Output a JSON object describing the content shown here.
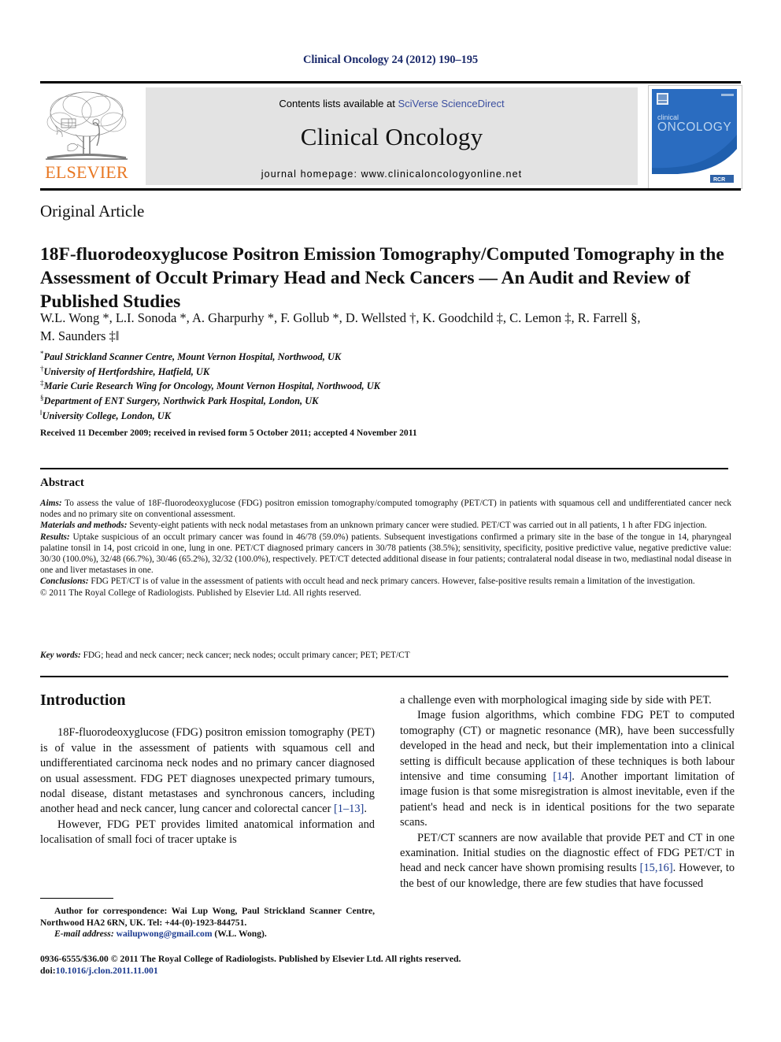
{
  "running_head": "Clinical Oncology 24 (2012) 190–195",
  "masthead": {
    "publisher_name": "ELSEVIER",
    "contents_prefix": "Contents lists available at ",
    "contents_link": "SciVerse ScienceDirect",
    "journal_title": "Clinical Oncology",
    "homepage_prefix": "journal homepage: ",
    "homepage_url": "www.clinicaloncologyonline.net",
    "cover": {
      "small_title": "clinical",
      "large_title": "ONCOLOGY",
      "footer_badge": "RCR"
    }
  },
  "article": {
    "type": "Original Article",
    "title": "18F-fluorodeoxyglucose Positron Emission Tomography/Computed Tomography in the Assessment of Occult Primary Head and Neck Cancers — An Audit and Review of Published Studies",
    "authors_line_1": "W.L. Wong *, L.I. Sonoda *, A. Gharpurhy *, F. Gollub *, D. Wellsted †, K. Goodchild ‡, C. Lemon ‡, R. Farrell §,",
    "authors_line_2": "M. Saunders ‡‖",
    "affiliations": [
      {
        "symbol": "*",
        "text": "Paul Strickland Scanner Centre, Mount Vernon Hospital, Northwood, UK"
      },
      {
        "symbol": "†",
        "text": "University of Hertfordshire, Hatfield, UK"
      },
      {
        "symbol": "‡",
        "text": "Marie Curie Research Wing for Oncology, Mount Vernon Hospital, Northwood, UK"
      },
      {
        "symbol": "§",
        "text": "Department of ENT Surgery, Northwick Park Hospital, London, UK"
      },
      {
        "symbol": "‖",
        "text": "University College, London, UK"
      }
    ],
    "history": "Received 11 December 2009; received in revised form 5 October 2011; accepted 4 November 2011"
  },
  "abstract": {
    "heading": "Abstract",
    "aims_label": "Aims:",
    "aims_text": " To assess the value of 18F-fluorodeoxyglucose (FDG) positron emission tomography/computed tomography (PET/CT) in patients with squamous cell and undifferentiated cancer neck nodes and no primary site on conventional assessment.",
    "methods_label": "Materials and methods:",
    "methods_text": " Seventy-eight patients with neck nodal metastases from an unknown primary cancer were studied. PET/CT was carried out in all patients, 1 h after FDG injection.",
    "results_label": "Results:",
    "results_text": " Uptake suspicious of an occult primary cancer was found in 46/78 (59.0%) patients. Subsequent investigations confirmed a primary site in the base of the tongue in 14, pharyngeal palatine tonsil in 14, post cricoid in one, lung in one. PET/CT diagnosed primary cancers in 30/78 patients (38.5%); sensitivity, specificity, positive predictive value, negative predictive value: 30/30 (100.0%), 32/48 (66.7%), 30/46 (65.2%), 32/32 (100.0%), respectively. PET/CT detected additional disease in four patients; contralateral nodal disease in two, mediastinal nodal disease in one and liver metastases in one.",
    "conclusions_label": "Conclusions:",
    "conclusions_text": " FDG PET/CT is of value in the assessment of patients with occult head and neck primary cancers. However, false-positive results remain a limitation of the investigation.",
    "copyright": "© 2011 The Royal College of Radiologists. Published by Elsevier Ltd. All rights reserved.",
    "keywords_label": "Key words:",
    "keywords_text": " FDG; head and neck cancer; neck cancer; neck nodes; occult primary cancer; PET; PET/CT"
  },
  "body": {
    "intro_heading": "Introduction",
    "left_para_1_a": "18F-fluorodeoxyglucose (FDG) positron emission tomography (PET) is of value in the assessment of patients with squamous cell and undifferentiated carcinoma neck nodes and no primary cancer diagnosed on usual assessment. FDG PET diagnoses unexpected primary tumours, nodal disease, distant metastases and synchronous cancers, including another head and neck cancer, lung cancer and colorectal cancer ",
    "left_para_1_ref": "[1–13]",
    "left_para_1_b": ".",
    "left_para_2": "However, FDG PET provides limited anatomical information and localisation of small foci of tracer uptake is",
    "right_para_1": "a challenge even with morphological imaging side by side with PET.",
    "right_para_2_a": "Image fusion algorithms, which combine FDG PET to computed tomography (CT) or magnetic resonance (MR), have been successfully developed in the head and neck, but their implementation into a clinical setting is difficult because application of these techniques is both labour intensive and time consuming ",
    "right_para_2_ref": "[14]",
    "right_para_2_b": ". Another important limitation of image fusion is that some misregistration is almost inevitable, even if the patient's head and neck is in identical positions for the two separate scans.",
    "right_para_3_a": "PET/CT scanners are now available that provide PET and CT in one examination. Initial studies on the diagnostic effect of FDG PET/CT in head and neck cancer have shown promising results ",
    "right_para_3_ref": "[15,16]",
    "right_para_3_b": ". However, to the best of our knowledge, there are few studies that have focussed"
  },
  "footnote": {
    "correspondence": "Author for correspondence: Wai Lup Wong, Paul Strickland Scanner Centre, Northwood HA2 6RN, UK. Tel: +44-(0)-1923-844751.",
    "email_label": "E-mail address:",
    "email": "wailupwong@gmail.com",
    "email_suffix": " (W.L. Wong)."
  },
  "footer": {
    "issn_line": "0936-6555/$36.00 © 2011 The Royal College of Radiologists. Published by Elsevier Ltd. All rights reserved.",
    "doi_label": "doi:",
    "doi": "10.1016/j.clon.2011.11.001"
  },
  "colors": {
    "link_blue": "#3b4fa0",
    "ref_blue": "#1b3a8f",
    "running_head_navy": "#1b2a6b",
    "elsevier_orange": "#E87722",
    "cover_blue": "#1f5fae",
    "band_grey": "#e3e3e3"
  }
}
